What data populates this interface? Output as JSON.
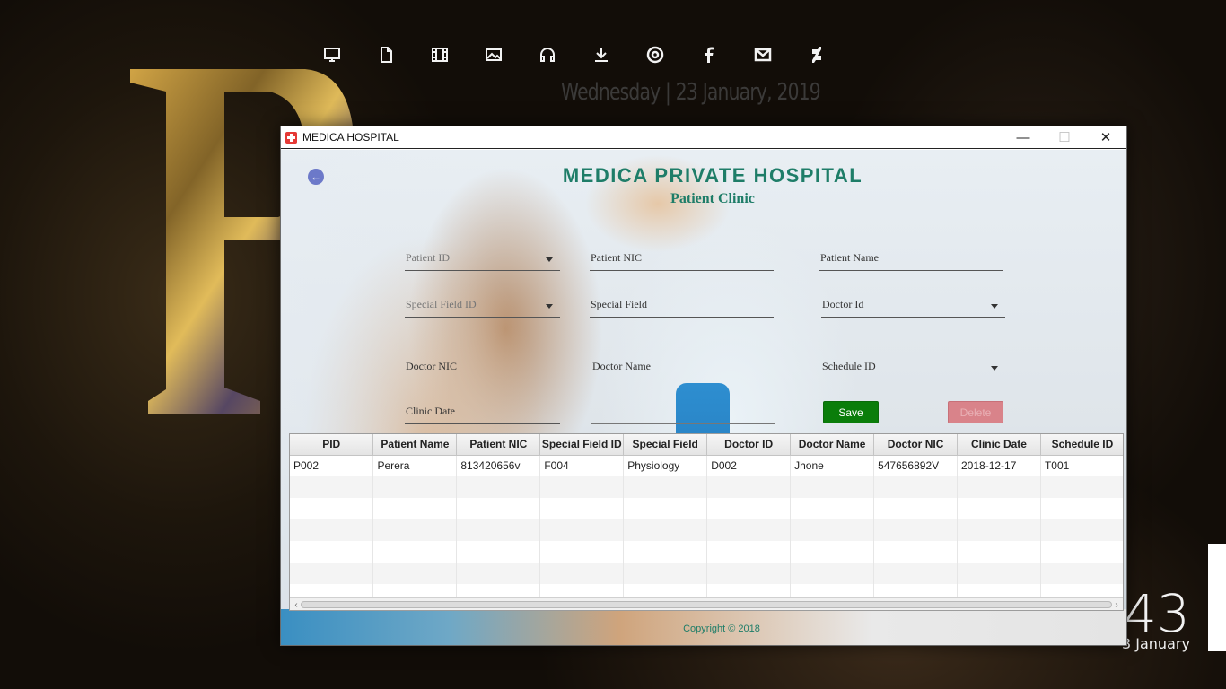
{
  "desktop": {
    "dock_icons": [
      "monitor-icon",
      "document-icon",
      "film-icon",
      "image-icon",
      "headphones-icon",
      "download-icon",
      "chrome-icon",
      "facebook-icon",
      "mail-icon",
      "deviantart-icon"
    ],
    "date_text": "Wednesday | 23 January, 2019",
    "clock_time": "43",
    "clock_date": "3 January"
  },
  "window": {
    "title": "MEDICA HOSPITAL",
    "controls": {
      "minimize": "—",
      "maximize": "☐",
      "close": "✕"
    }
  },
  "header": {
    "title": "MEDICA  PRIVATE  HOSPITAL",
    "subtitle": "Patient Clinic"
  },
  "form": {
    "patient_id": "Patient ID",
    "patient_nic": "Patient NIC",
    "patient_name": "Patient Name",
    "special_field_id": "Special Field ID",
    "special_field": "Special Field",
    "doctor_id": "Doctor Id",
    "doctor_nic": "Doctor NIC",
    "doctor_name": "Doctor Name",
    "schedule_id": "Schedule ID",
    "clinic_date": "Clinic Date",
    "save_label": "Save",
    "delete_label": "Delete"
  },
  "table": {
    "headers": [
      "PID",
      "Patient Name",
      "Patient NIC",
      "Special Field ID",
      "Special Field",
      "Doctor ID",
      "Doctor Name",
      "Doctor NIC",
      "Clinic Date",
      "Schedule ID"
    ],
    "rows": [
      [
        "P002",
        "Perera",
        "813420656v",
        "F004",
        "Physiology",
        "D002",
        "Jhone",
        "547656892V",
        "2018-12-17",
        "T001"
      ]
    ]
  },
  "footer": {
    "copyright": "Copyright © 2018"
  },
  "colors": {
    "accent": "#1e7d68",
    "save": "#0a7d0a",
    "delete": "#d9838a"
  }
}
